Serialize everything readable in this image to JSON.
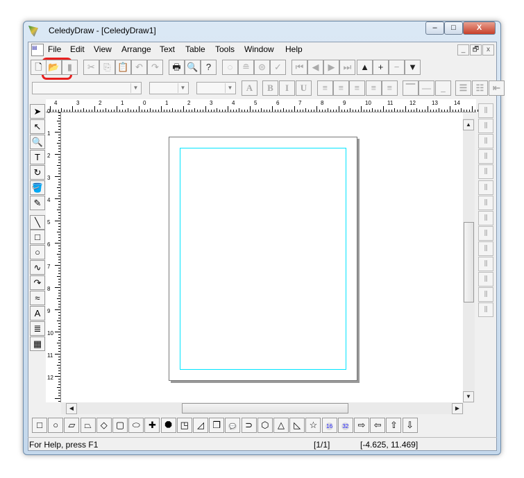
{
  "window": {
    "title": "CeledyDraw - [CeledyDraw1]",
    "minimize": "–",
    "maximize": "□",
    "close": "X"
  },
  "menu": {
    "items": [
      {
        "u": "F",
        "rest": "ile"
      },
      {
        "u": "E",
        "rest": "dit"
      },
      {
        "u": "V",
        "rest": "iew"
      },
      {
        "u": "A",
        "rest": "rrange"
      },
      {
        "u": "T",
        "rest": "ext"
      },
      {
        "u": "Ta",
        "rest": "ble"
      },
      {
        "u": "T",
        "rest": "ools",
        "pre": ""
      },
      {
        "u": "W",
        "rest": "indow"
      },
      {
        "u": "H",
        "rest": "elp"
      }
    ],
    "labels": [
      "File",
      "Edit",
      "View",
      "Arrange",
      "Text",
      "Table",
      "Tools",
      "Window",
      "Help"
    ],
    "mdi": [
      "_",
      "🗗",
      "x"
    ]
  },
  "toolbar": [
    {
      "name": "new-icon",
      "g": "🗋"
    },
    {
      "name": "open-icon",
      "g": "📂",
      "highlight": true
    },
    {
      "name": "save-icon",
      "g": "▮",
      "dis": true
    },
    {
      "name": "cut-icon",
      "g": "✂",
      "dis": true
    },
    {
      "name": "copy-icon",
      "g": "⎘",
      "dis": true
    },
    {
      "name": "paste-icon",
      "g": "📋"
    },
    {
      "name": "undo-icon",
      "g": "↶",
      "dis": true
    },
    {
      "name": "redo-icon",
      "g": "↷",
      "dis": true
    },
    {
      "name": "print-icon",
      "g": "🖶"
    },
    {
      "name": "print-preview-icon",
      "g": "🔍"
    },
    {
      "name": "help-icon",
      "g": "?"
    },
    {
      "name": "circle-text-icon",
      "g": "◌",
      "dis": true
    },
    {
      "name": "text-shape-icon",
      "g": "≘",
      "dis": true
    },
    {
      "name": "text-circle-icon",
      "g": "⊜",
      "dis": true
    },
    {
      "name": "spellcheck-icon",
      "g": "✓",
      "dis": true
    },
    {
      "name": "first-page-icon",
      "g": "⏮",
      "dis": true
    },
    {
      "name": "prev-page-icon",
      "g": "◀",
      "dis": true
    },
    {
      "name": "next-page-icon",
      "g": "▶",
      "dis": true
    },
    {
      "name": "last-page-icon",
      "g": "⏭",
      "dis": true
    },
    {
      "name": "move-up-icon",
      "g": "▲"
    },
    {
      "name": "add-page-icon",
      "g": "+"
    },
    {
      "name": "remove-page-icon",
      "g": "−",
      "dis": true
    },
    {
      "name": "move-down-icon",
      "g": "▼"
    }
  ],
  "format_bar": {
    "buttons": [
      {
        "name": "font-effects-icon",
        "g": "A"
      },
      {
        "name": "bold-icon",
        "g": "B"
      },
      {
        "name": "italic-icon",
        "g": "I"
      },
      {
        "name": "underline-icon",
        "g": "U"
      },
      {
        "name": "align-left-icon",
        "g": "≡"
      },
      {
        "name": "align-center-icon",
        "g": "≡"
      },
      {
        "name": "align-right-icon",
        "g": "≡"
      },
      {
        "name": "justify-icon",
        "g": "≡"
      },
      {
        "name": "justify-all-icon",
        "g": "≡"
      },
      {
        "name": "valign-top-icon",
        "g": "⎺"
      },
      {
        "name": "valign-middle-icon",
        "g": "—"
      },
      {
        "name": "valign-bottom-icon",
        "g": "_"
      },
      {
        "name": "numbered-list-icon",
        "g": "☰"
      },
      {
        "name": "bullet-list-icon",
        "g": "☷"
      },
      {
        "name": "indent-icon",
        "g": "⇤"
      }
    ]
  },
  "ruler": {
    "h": [
      "4",
      "3",
      "2",
      "1",
      "0",
      "1",
      "2",
      "3",
      "4",
      "5",
      "6",
      "7",
      "8",
      "9",
      "10",
      "11",
      "12",
      "13",
      "14"
    ],
    "v": [
      "0",
      "1",
      "2",
      "3",
      "4",
      "5",
      "6",
      "7",
      "8",
      "9",
      "10",
      "11",
      "12"
    ]
  },
  "tools": [
    {
      "name": "select-arrow-icon",
      "g": "➤"
    },
    {
      "name": "node-edit-icon",
      "g": "↖"
    },
    {
      "name": "zoom-icon",
      "g": "🔍"
    },
    {
      "name": "text-tool-icon",
      "g": "T"
    },
    {
      "name": "rotate-icon",
      "g": "↻"
    },
    {
      "name": "fill-icon",
      "g": "🪣"
    },
    {
      "name": "pen-icon",
      "g": "✎"
    },
    {
      "name": "line-icon",
      "g": "╲"
    },
    {
      "name": "rectangle-icon",
      "g": "□"
    },
    {
      "name": "ellipse-icon",
      "g": "○"
    },
    {
      "name": "curve-icon",
      "g": "∿"
    },
    {
      "name": "arc-icon",
      "g": "↷"
    },
    {
      "name": "freehand-icon",
      "g": "≈"
    },
    {
      "name": "art-text-icon",
      "g": "A"
    },
    {
      "name": "paragraph-icon",
      "g": "≣"
    },
    {
      "name": "table-icon",
      "g": "▦"
    }
  ],
  "align_tools": [
    "align-left-edges-icon",
    "align-hcenter-icon",
    "align-right-edges-icon",
    "align-top-icon",
    "align-vcenter-icon",
    "align-bottom-icon",
    "distribute-top-icon",
    "distribute-vcenter-icon",
    "distribute-bottom-icon",
    "distribute-height-icon",
    "distribute-left-icon",
    "distribute-hcenter-icon",
    "distribute-right-icon",
    "distribute-width-icon"
  ],
  "shapes": [
    {
      "name": "rect-shape-icon",
      "g": "□"
    },
    {
      "name": "circle-shape-icon",
      "g": "○"
    },
    {
      "name": "parallelogram-shape-icon",
      "g": "▱"
    },
    {
      "name": "trapezoid-shape-icon",
      "g": "⏢"
    },
    {
      "name": "diamond-shape-icon",
      "g": "◇"
    },
    {
      "name": "rounded-rect-shape-icon",
      "g": "▢"
    },
    {
      "name": "octagon-ellipse-shape-icon",
      "g": "⬭"
    },
    {
      "name": "cross-shape-icon",
      "g": "✚"
    },
    {
      "name": "octagon-shape-icon",
      "g": "⯃"
    },
    {
      "name": "snip-rect-shape-icon",
      "g": "◳"
    },
    {
      "name": "slant-rect-shape-icon",
      "g": "◿"
    },
    {
      "name": "cube-shape-icon",
      "g": "❒"
    },
    {
      "name": "callout-shape-icon",
      "g": "💬"
    },
    {
      "name": "tag-shape-icon",
      "g": "⊃"
    },
    {
      "name": "hexagon-shape-icon",
      "g": "⬡"
    },
    {
      "name": "triangle-shape-icon",
      "g": "△"
    },
    {
      "name": "right-triangle-shape-icon",
      "g": "◺"
    },
    {
      "name": "star-shape-icon",
      "g": "☆"
    },
    {
      "name": "seal16-shape-icon",
      "g": "16"
    },
    {
      "name": "seal32-shape-icon",
      "g": "32"
    },
    {
      "name": "arrow-right-shape-icon",
      "g": "⇨"
    },
    {
      "name": "arrow-left-shape-icon",
      "g": "⇦"
    },
    {
      "name": "arrow-up-shape-icon",
      "g": "⇧"
    },
    {
      "name": "arrow-down-shape-icon",
      "g": "⇩"
    }
  ],
  "status": {
    "help": "For Help, press F1",
    "page": "[1/1]",
    "coords": "[-4.625, 11.469]"
  },
  "colors": {
    "highlight": "#e8201f",
    "margin": "#00e5ff"
  }
}
